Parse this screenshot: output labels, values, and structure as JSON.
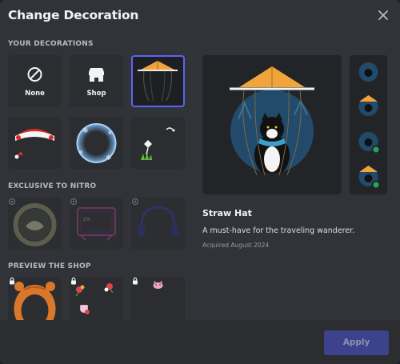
{
  "header": {
    "title": "Change Decoration"
  },
  "sections": {
    "yours": "YOUR DECORATIONS",
    "nitro": "EXCLUSIVE TO NITRO",
    "shop": "PREVIEW THE SHOP"
  },
  "your_decorations": [
    {
      "label": "None",
      "icon": "ban-icon"
    },
    {
      "label": "Shop",
      "icon": "storefront-icon"
    },
    {
      "label": "",
      "icon": "straw-hat-decoration",
      "selected": true
    },
    {
      "label": "",
      "icon": "santa-hat-decoration"
    },
    {
      "label": "",
      "icon": "snow-globe-decoration"
    },
    {
      "label": "",
      "icon": "flower-vine-decoration"
    }
  ],
  "nitro_decorations": [
    {
      "icon": "leaf-wreath-decoration"
    },
    {
      "icon": "neon-frame-decoration"
    },
    {
      "icon": "headphones-decoration"
    }
  ],
  "shop_preview": [
    {
      "icon": "bear-hood-decoration",
      "locked": true
    },
    {
      "icon": "flower-bouquet-decoration",
      "locked": true
    },
    {
      "icon": "pink-pet-decoration",
      "locked": true
    }
  ],
  "details": {
    "name": "Straw Hat",
    "description": "A must-have for the traveling wanderer.",
    "acquired": "Acquired August 2024"
  },
  "footer": {
    "apply_label": "Apply"
  },
  "colors": {
    "accent": "#5865f2",
    "background": "#313338",
    "tile": "#2b2d31",
    "online": "#23a55a"
  }
}
